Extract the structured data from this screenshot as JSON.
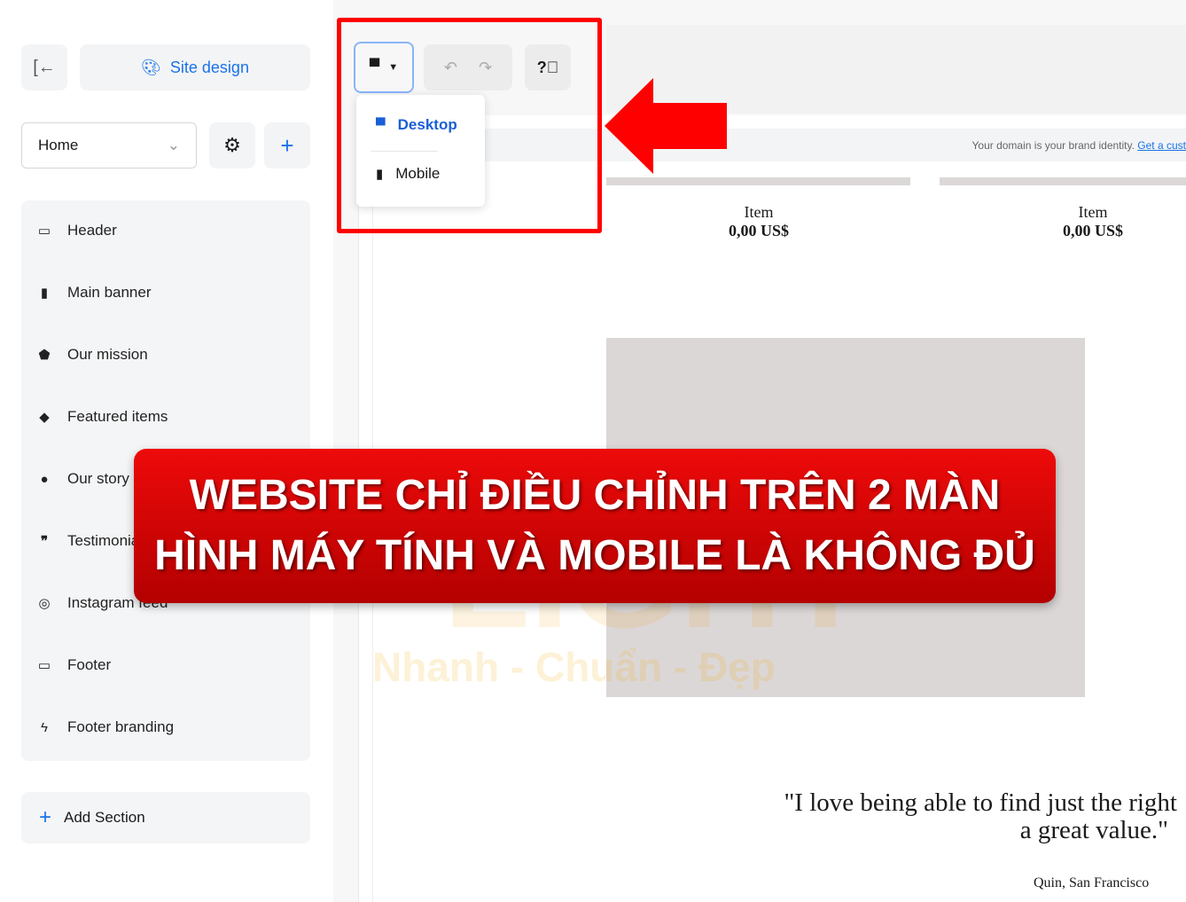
{
  "sidebar": {
    "site_design_label": "Site design",
    "page_select_value": "Home",
    "sections": [
      {
        "label": "Header",
        "icon": "header-icon"
      },
      {
        "label": "Main banner",
        "icon": "bookmark-icon"
      },
      {
        "label": "Our mission",
        "icon": "shield-icon"
      },
      {
        "label": "Featured items",
        "icon": "tag-icon"
      },
      {
        "label": "Our story",
        "icon": "chat-icon"
      },
      {
        "label": "Testimonials",
        "icon": "quote-icon"
      },
      {
        "label": "Instagram feed",
        "icon": "instagram-icon"
      },
      {
        "label": "Footer",
        "icon": "footer-icon"
      },
      {
        "label": "Footer branding",
        "icon": "bolt-icon"
      }
    ],
    "add_section_label": "Add Section"
  },
  "toolbar": {
    "device_menu": {
      "options": [
        {
          "label": "Desktop",
          "selected": true
        },
        {
          "label": "Mobile",
          "selected": false
        }
      ]
    }
  },
  "preview": {
    "domain_notice": "Your domain is your brand identity.",
    "domain_link": "Get a cust",
    "items": [
      {
        "name": "Item",
        "price": "0,00 US$"
      },
      {
        "name": "Item",
        "price": "0,00 US$"
      }
    ],
    "quote_line1": "\"I love being able to find just the right",
    "quote_line2": "a great value.\"",
    "quote_author": "Quin, San Francisco"
  },
  "overlay": {
    "banner_line1": "WEBSITE CHỈ ĐIỀU CHỈNH TRÊN 2 MÀN",
    "banner_line2": "HÌNH MÁY TÍNH VÀ MOBILE LÀ KHÔNG ĐỦ",
    "watermark": "LIGHT Nhanh - Chuẩn - Đẹp",
    "highlight_color": "#ff0000"
  },
  "colors": {
    "accent": "#1a73e8",
    "banner": "#d90000"
  }
}
